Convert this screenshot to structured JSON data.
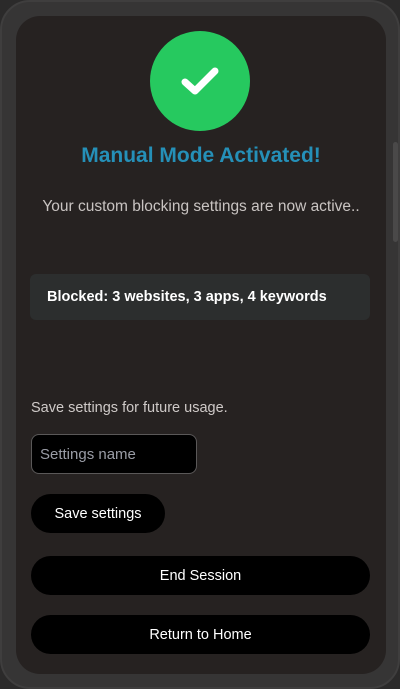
{
  "icons": {
    "success": "check-icon"
  },
  "colors": {
    "success_green": "#26c95f",
    "title_blue": "#2590b8",
    "background": "#262221",
    "button": "#000000"
  },
  "status": {
    "title": "Manual Mode Activated!",
    "subtitle": "Your custom blocking settings are now active..",
    "summary_prefix": "Blocked:",
    "summary_text": "3 websites, 3 apps, 4 keywords"
  },
  "settings": {
    "label": "Save settings for future usage.",
    "name_placeholder": "Settings name",
    "name_value": "",
    "save_label": "Save settings"
  },
  "actions": {
    "end_session_label": "End Session",
    "return_home_label": "Return to Home"
  }
}
